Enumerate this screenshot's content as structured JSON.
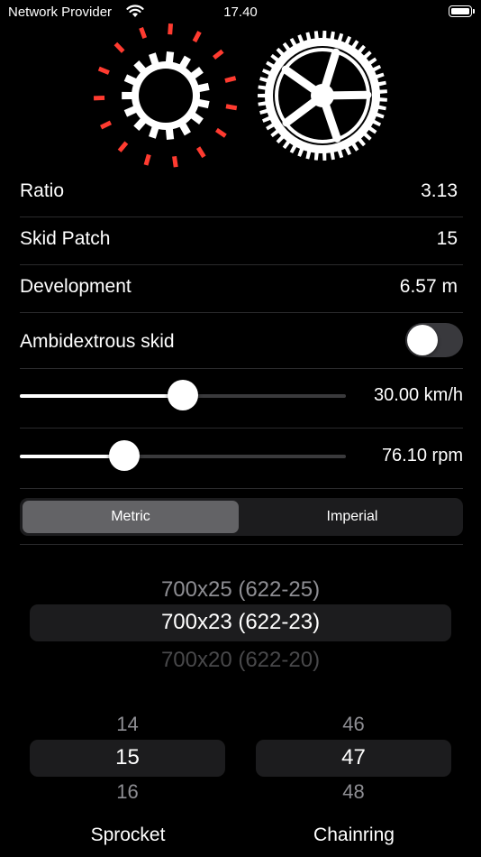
{
  "status_bar": {
    "carrier": "Network Provider",
    "time": "17.40"
  },
  "colors": {
    "accent": "#ff3b30",
    "background": "#000000",
    "toggle_off": "#39393d"
  },
  "stats": {
    "ratio_label": "Ratio",
    "ratio_value": "3.13",
    "skid_label": "Skid Patch",
    "skid_value": "15",
    "development_label": "Development",
    "development_value": "6.57 m",
    "ambidextrous_label": "Ambidextrous skid",
    "ambidextrous_on": false
  },
  "speed": {
    "value_label": "30.00 km/h",
    "fraction": 0.5
  },
  "cadence": {
    "value_label": "76.10 rpm",
    "fraction": 0.32
  },
  "units": {
    "metric_label": "Metric",
    "imperial_label": "Imperial",
    "selected": "metric"
  },
  "tire_picker": {
    "above": "700x25 (622-25)",
    "selected": "700x23 (622-23)",
    "below": "700x20 (622-20)"
  },
  "sprocket_picker": {
    "above": "14",
    "selected": "15",
    "below": "16",
    "label": "Sprocket"
  },
  "chainring_picker": {
    "above": "46",
    "selected": "47",
    "below": "48",
    "label": "Chainring"
  },
  "icons": [
    "wifi-icon",
    "battery-icon",
    "sprocket-gear-icon",
    "chainring-gear-icon"
  ]
}
